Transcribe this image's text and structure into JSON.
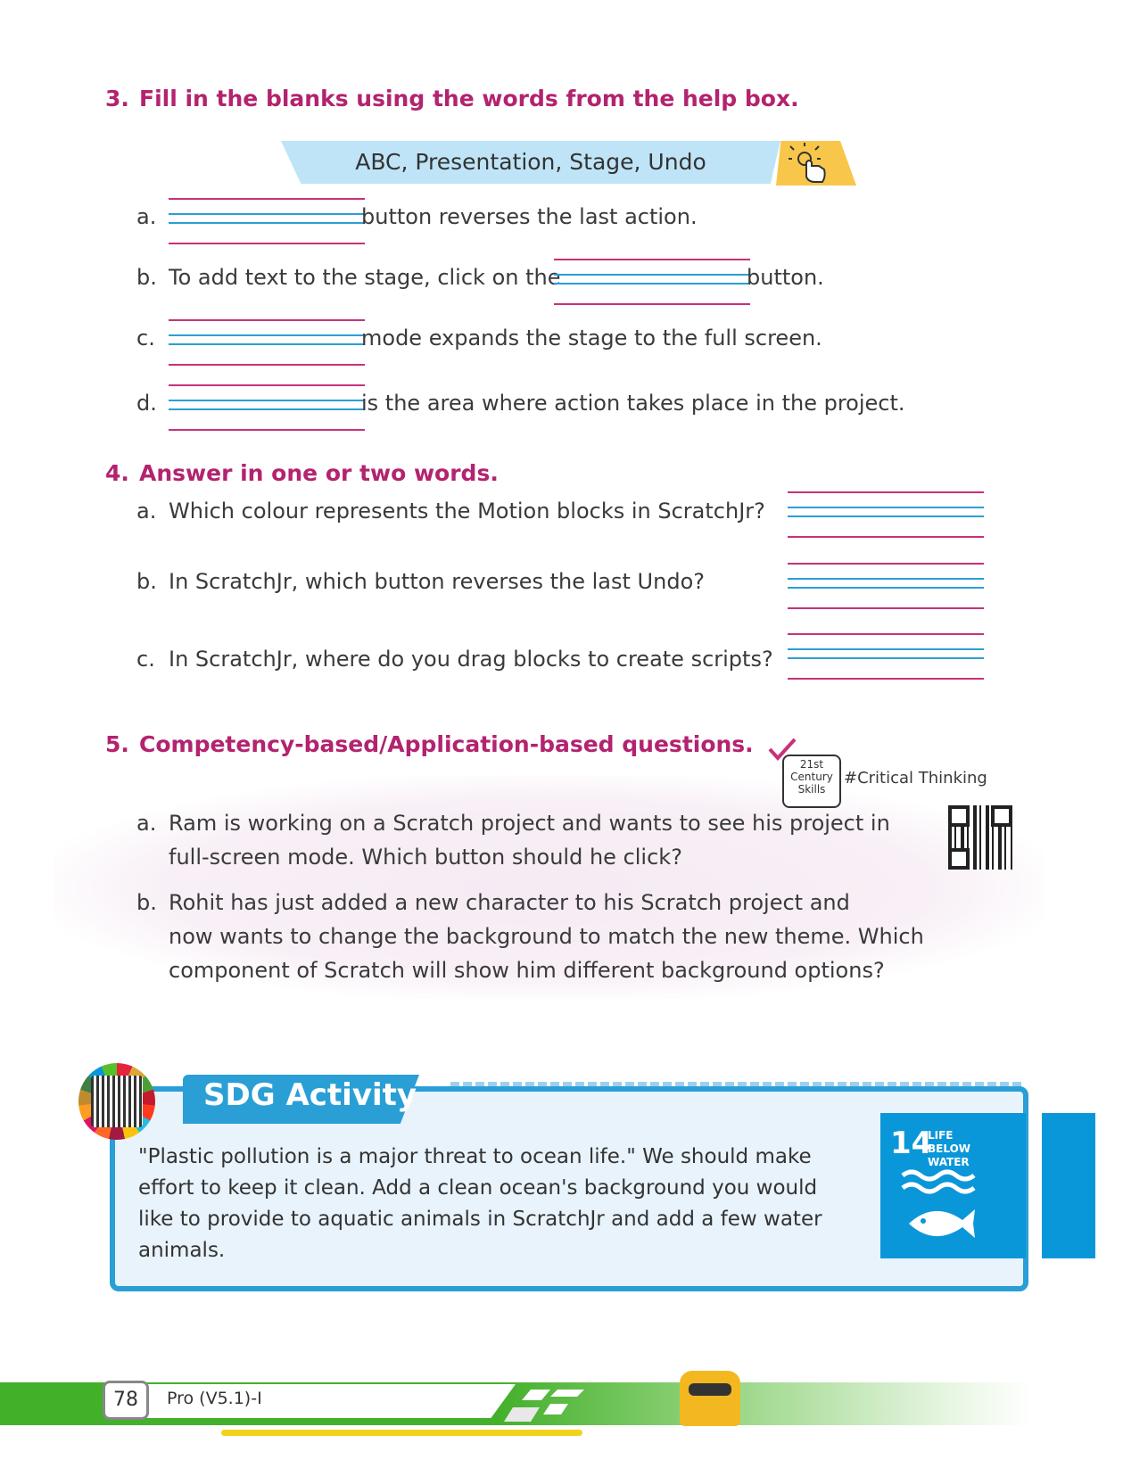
{
  "q3": {
    "number": "3.",
    "heading": "Fill in the blanks using the words from the help box.",
    "help_box": "ABC, Presentation, Stage, Undo",
    "items": [
      {
        "label": "a.",
        "before": "",
        "after": "button reverses the last action."
      },
      {
        "label": "b.",
        "before": "To add text to the stage, click on the",
        "after": "button."
      },
      {
        "label": "c.",
        "before": "",
        "after": "mode expands the stage to the full screen."
      },
      {
        "label": "d.",
        "before": "",
        "after": "is the area where action takes place in the project."
      }
    ]
  },
  "q4": {
    "number": "4.",
    "heading": "Answer in one or two words.",
    "items": [
      {
        "label": "a.",
        "text": "Which colour represents the Motion blocks in ScratchJr?"
      },
      {
        "label": "b.",
        "text": "In ScratchJr, which button reverses the last Undo?"
      },
      {
        "label": "c.",
        "text": "In ScratchJr, where do you drag blocks to create scripts?"
      }
    ]
  },
  "q5": {
    "number": "5.",
    "heading": "Competency-based/Application-based questions.",
    "skills_badge": {
      "line1": "21st",
      "line2": "Century",
      "line3": "Skills"
    },
    "tag": "#Critical Thinking",
    "items": [
      {
        "label": "a.",
        "lines": [
          "Ram is working on a Scratch project and wants to see his project in",
          "full-screen mode. Which button should he click?"
        ]
      },
      {
        "label": "b.",
        "lines": [
          "Rohit has just added a new character to his Scratch project and",
          "now wants to change the background to match the new theme. Which",
          "component of Scratch will show him different background options?"
        ]
      }
    ]
  },
  "sdg": {
    "title": "SDG Activity",
    "text": "\"Plastic pollution is a major threat to ocean life.\" We should make effort to keep it clean. Add a clean ocean's background you would like to provide to aquatic animals in ScratchJr and add a few water animals.",
    "goal_number": "14",
    "goal_label_1": "LIFE",
    "goal_label_2": "BELOW WATER",
    "goal_color": "#0a97d9"
  },
  "footer": {
    "page_number": "78",
    "book": "Pro (V5.1)-I"
  },
  "colors": {
    "heading": "#b3236f",
    "blank_pink": "#c8317a",
    "blank_blue": "#2a9fd6",
    "footer_green": "#43b02a"
  }
}
